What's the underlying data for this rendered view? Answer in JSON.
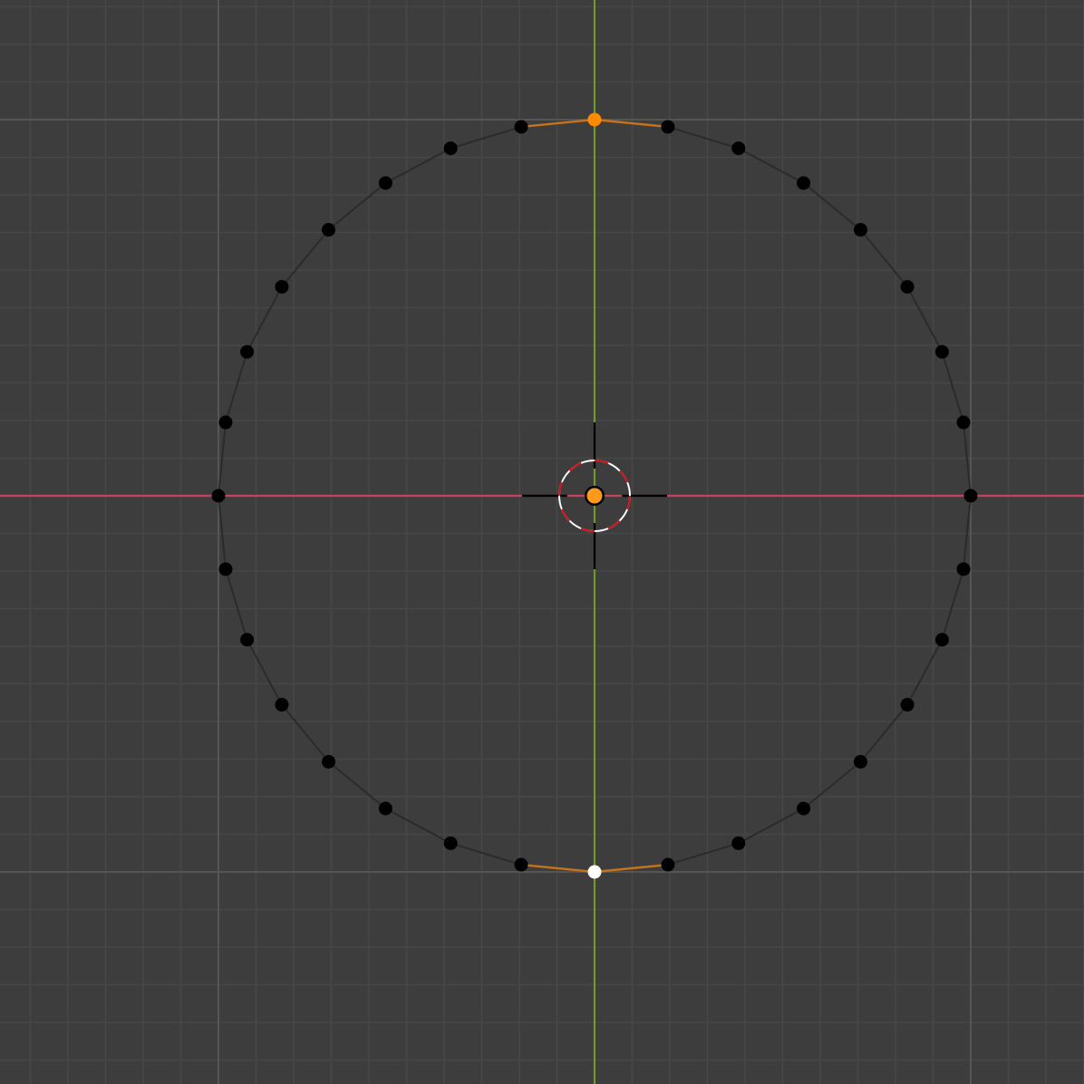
{
  "editor": {
    "type": "3d-viewport",
    "view": "top-orthographic",
    "mode": "edit-mode",
    "select_mode": "vertex"
  },
  "colors": {
    "background": "#3d3d3d",
    "grid_minor": "#474747",
    "grid_major": "#555555",
    "x_axis": "#c8435a",
    "y_axis": "#6f9a27",
    "edge": "#2b2b2b",
    "vertex": "#000000",
    "vertex_active": "#ffffff",
    "vertex_selected": "#ff8a00",
    "edge_selected": "#c7731a",
    "origin": "#ff9a1a",
    "cursor_ring_white": "#ffffff",
    "cursor_ring_red": "#d3101a",
    "cursor_crosshair": "#000000"
  },
  "mesh": {
    "object": "circle",
    "vertex_count": 32,
    "selected_vertex_indices": [
      0
    ],
    "active_vertex_index": 16,
    "highlighted_edges": [
      [
        31,
        0
      ],
      [
        0,
        1
      ],
      [
        15,
        16
      ],
      [
        16,
        17
      ]
    ]
  },
  "grid": {
    "subdivisions_per_major": 10,
    "major_every_units": 10
  },
  "icons": {
    "3d_cursor": "crosshair-ring-icon",
    "object_origin": "origin-dot-icon"
  }
}
